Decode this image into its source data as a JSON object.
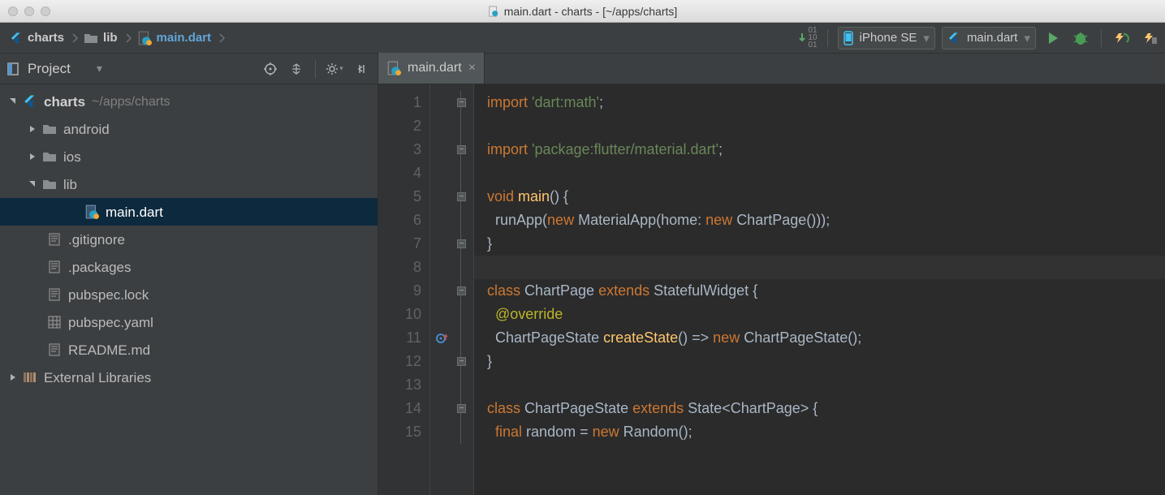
{
  "window": {
    "title": "main.dart - charts - [~/apps/charts]"
  },
  "breadcrumbs": {
    "items": [
      "charts",
      "lib",
      "main.dart"
    ]
  },
  "navbar": {
    "device": "iPhone SE",
    "runconfig": "main.dart"
  },
  "sidebar": {
    "title": "Project",
    "root": {
      "name": "charts",
      "hint": "~/apps/charts"
    },
    "items": [
      "android",
      "ios",
      "lib"
    ],
    "lib_file": "main.dart",
    "files": [
      ".gitignore",
      ".packages",
      "pubspec.lock",
      "pubspec.yaml",
      "README.md"
    ],
    "external": "External Libraries"
  },
  "tab": {
    "label": "main.dart"
  },
  "code": {
    "lines": [
      {
        "n": 1,
        "html": "<span class='kw'>import </span><span class='str'>'dart:math'</span>;"
      },
      {
        "n": 2,
        "html": ""
      },
      {
        "n": 3,
        "html": "<span class='kw'>import </span><span class='str'>'package:flutter/material.dart'</span>;"
      },
      {
        "n": 4,
        "html": ""
      },
      {
        "n": 5,
        "html": "<span class='kw'>void </span><span class='fn'>main</span>() {"
      },
      {
        "n": 6,
        "html": "  runApp(<span class='kw'>new </span>MaterialApp(home: <span class='kw'>new </span>ChartPage()));"
      },
      {
        "n": 7,
        "html": "}"
      },
      {
        "n": 8,
        "html": ""
      },
      {
        "n": 9,
        "html": "<span class='kw'>class </span>ChartPage <span class='kw'>extends </span>StatefulWidget {"
      },
      {
        "n": 10,
        "html": "  <span class='ann'>@override</span>"
      },
      {
        "n": 11,
        "html": "  ChartPageState <span class='fn'>createState</span>() =&gt; <span class='kw'>new </span>ChartPageState();"
      },
      {
        "n": 12,
        "html": "}"
      },
      {
        "n": 13,
        "html": ""
      },
      {
        "n": 14,
        "html": "<span class='kw'>class </span>ChartPageState <span class='kw'>extends </span>State&lt;ChartPage&gt; {"
      },
      {
        "n": 15,
        "html": "  <span class='kw'>final </span>random = <span class='kw'>new </span>Random();"
      }
    ]
  }
}
